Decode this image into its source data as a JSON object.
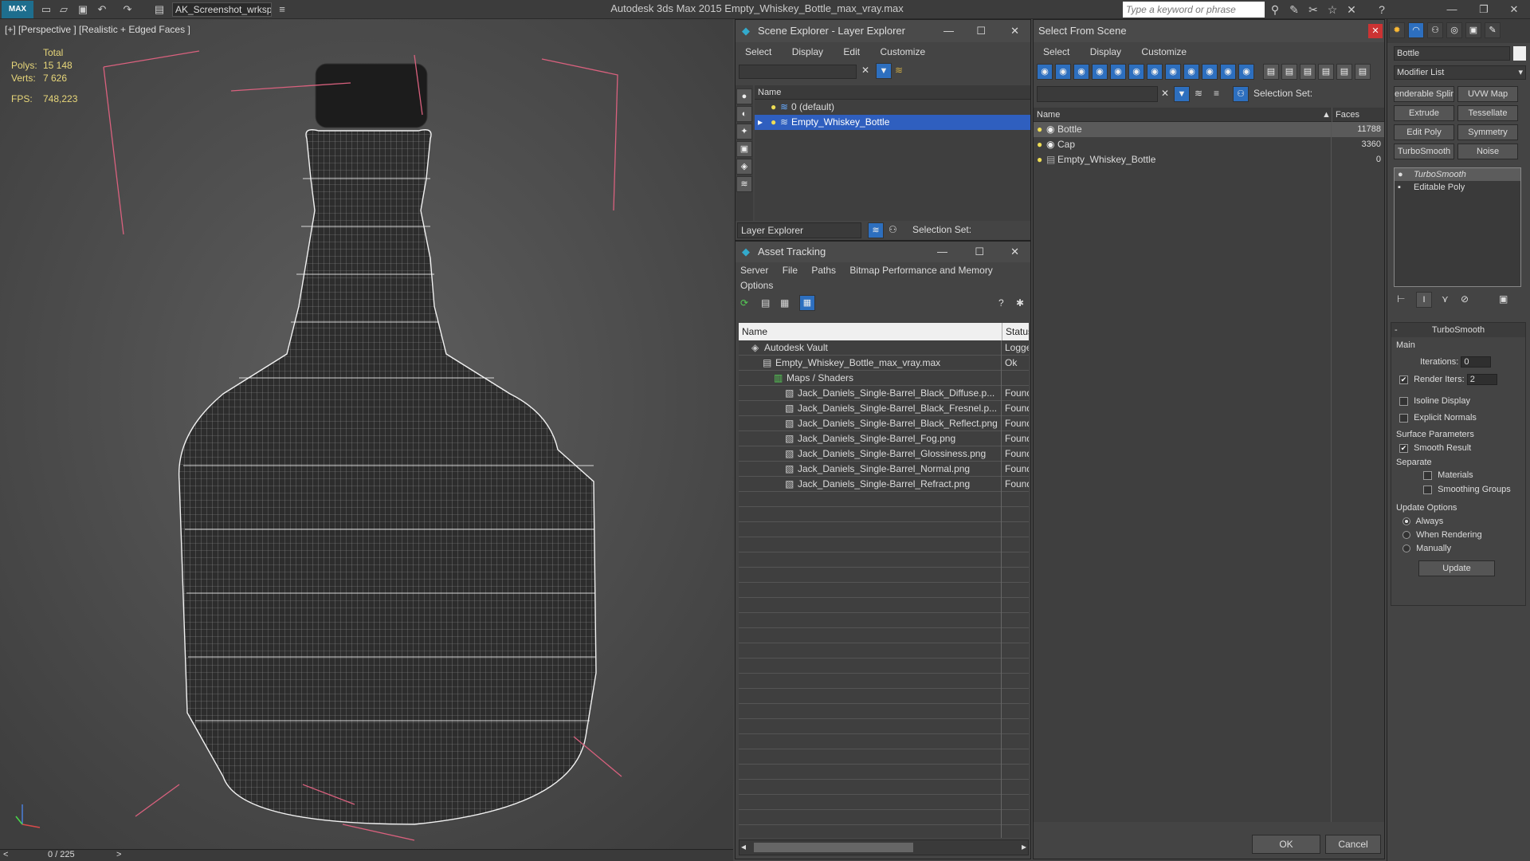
{
  "app": {
    "logo": "MAX",
    "title": "Autodesk 3ds Max  2015     Empty_Whiskey_Bottle_max_vray.max",
    "workspace": "AK_Screenshot_wrksp",
    "search_placeholder": "Type a keyword or phrase"
  },
  "viewport": {
    "label": "[+] [Perspective ] [Realistic + Edged Faces ]",
    "stats": {
      "header": "Total",
      "polys_label": "Polys:",
      "polys": "15 148",
      "verts_label": "Verts:",
      "verts": "7 626",
      "fps_label": "FPS:",
      "fps": "748,223"
    },
    "timeline": "0 / 225",
    "prev": "<",
    "next": ">"
  },
  "scene_explorer": {
    "title": "Scene Explorer - Layer Explorer",
    "menu": [
      "Select",
      "Display",
      "Edit",
      "Customize"
    ],
    "column": "Name",
    "rows": [
      "0 (default)",
      "Empty_Whiskey_Bottle"
    ],
    "footer_label": "Layer Explorer",
    "selection_set": "Selection Set:"
  },
  "asset_tracking": {
    "title": "Asset Tracking",
    "menu1": [
      "Server",
      "File",
      "Paths",
      "Bitmap Performance and Memory"
    ],
    "menu2": [
      "Options"
    ],
    "col_name": "Name",
    "col_status": "Status",
    "rows": [
      {
        "name": "Autodesk Vault",
        "status": "Logge",
        "indent": 0
      },
      {
        "name": "Empty_Whiskey_Bottle_max_vray.max",
        "status": "Ok",
        "indent": 1
      },
      {
        "name": "Maps / Shaders",
        "status": "",
        "indent": 2
      },
      {
        "name": "Jack_Daniels_Single-Barrel_Black_Diffuse.p...",
        "status": "Found",
        "indent": 3
      },
      {
        "name": "Jack_Daniels_Single-Barrel_Black_Fresnel.p...",
        "status": "Found",
        "indent": 3
      },
      {
        "name": "Jack_Daniels_Single-Barrel_Black_Reflect.png",
        "status": "Found",
        "indent": 3
      },
      {
        "name": "Jack_Daniels_Single-Barrel_Fog.png",
        "status": "Found",
        "indent": 3
      },
      {
        "name": "Jack_Daniels_Single-Barrel_Glossiness.png",
        "status": "Found",
        "indent": 3
      },
      {
        "name": "Jack_Daniels_Single-Barrel_Normal.png",
        "status": "Found",
        "indent": 3
      },
      {
        "name": "Jack_Daniels_Single-Barrel_Refract.png",
        "status": "Found",
        "indent": 3
      }
    ]
  },
  "select_from_scene": {
    "title": "Select From Scene",
    "menu": [
      "Select",
      "Display",
      "Customize"
    ],
    "selection_set": "Selection Set:",
    "col_name": "Name",
    "col_faces": "Faces",
    "rows": [
      {
        "name": "Bottle",
        "faces": "11788"
      },
      {
        "name": "Cap",
        "faces": "3360"
      },
      {
        "name": "Empty_Whiskey_Bottle",
        "faces": "0"
      }
    ],
    "ok": "OK",
    "cancel": "Cancel"
  },
  "command_panel": {
    "object_name": "Bottle",
    "modifier_list": "Modifier List",
    "buttons": [
      "enderable Splir",
      "UVW Map",
      "Extrude",
      "Tessellate",
      "Edit Poly",
      "Symmetry",
      "TurboSmooth",
      "Noise"
    ],
    "stack": [
      "TurboSmooth",
      "Editable Poly"
    ],
    "rollout_title": "TurboSmooth",
    "main": "Main",
    "iterations_label": "Iterations:",
    "iterations": "0",
    "render_iters_label": "Render Iters:",
    "render_iters": "2",
    "isoline": "Isoline Display",
    "explicit_normals": "Explicit Normals",
    "surface_params": "Surface Parameters",
    "smooth_result": "Smooth Result",
    "separate": "Separate",
    "materials": "Materials",
    "smoothing_groups": "Smoothing Groups",
    "update_options": "Update Options",
    "always": "Always",
    "when_rendering": "When Rendering",
    "manually": "Manually",
    "update": "Update"
  }
}
